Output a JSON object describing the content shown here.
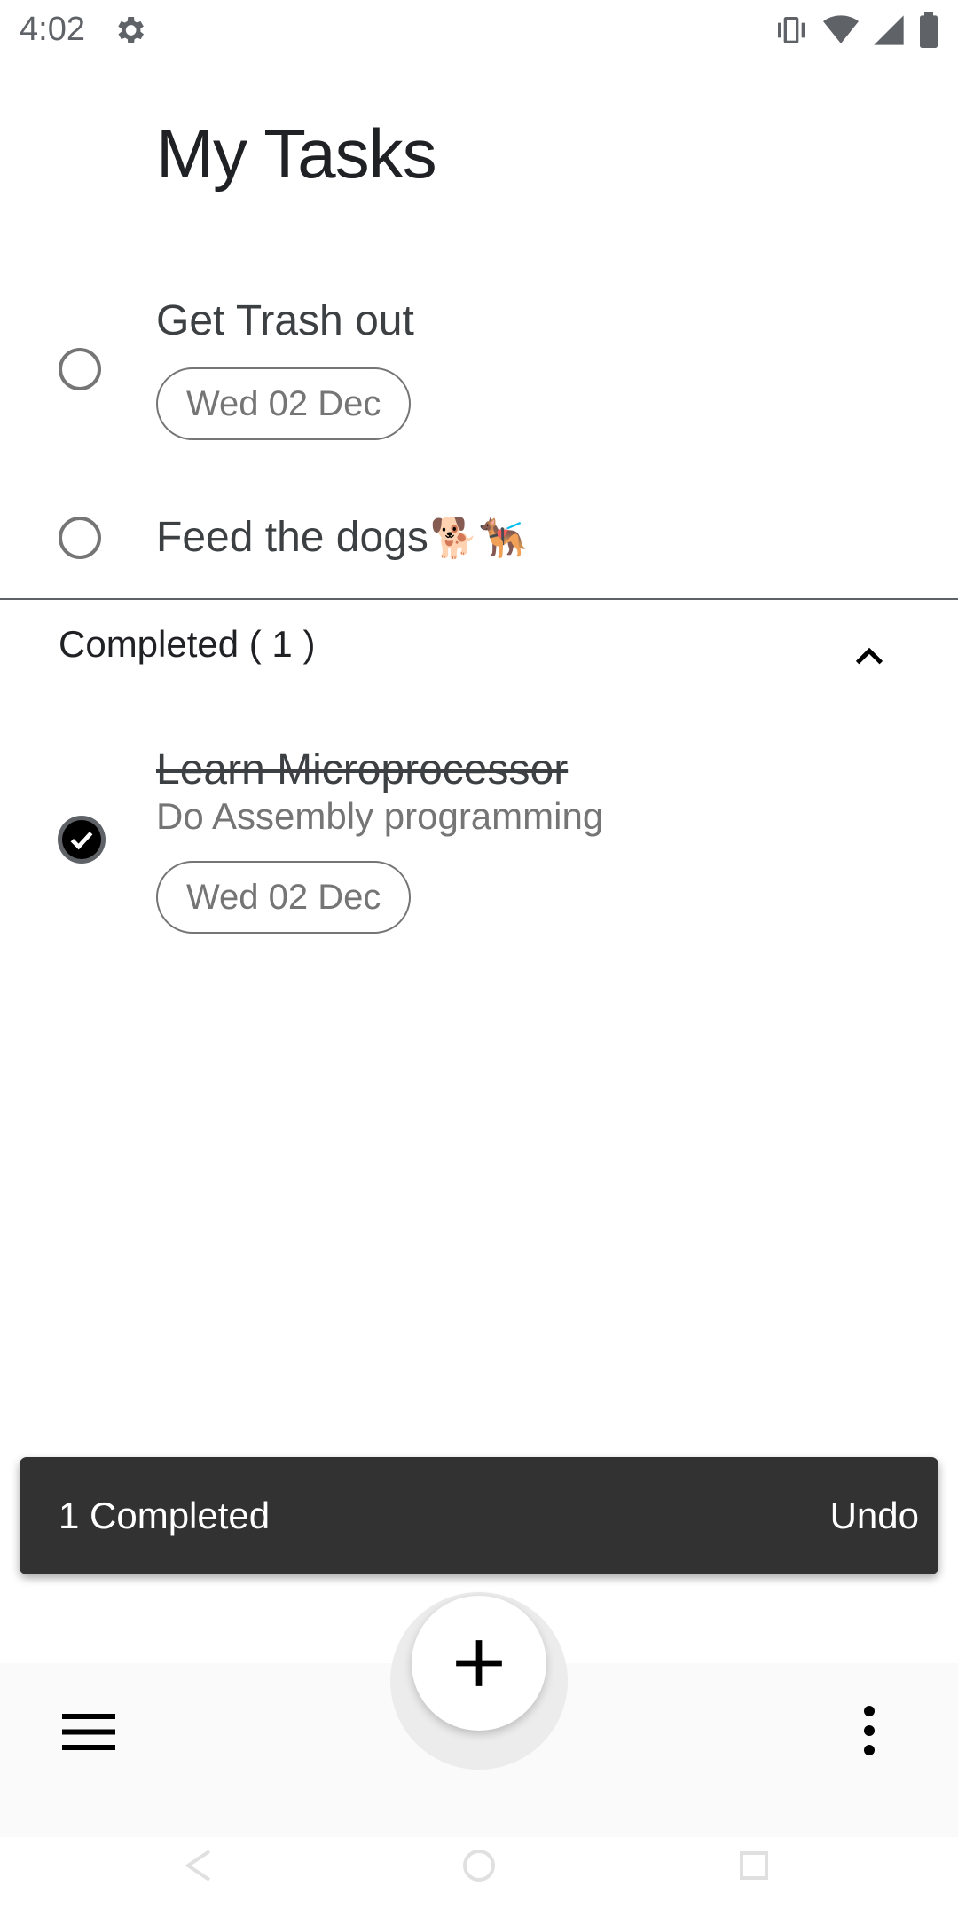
{
  "status_bar": {
    "time": "4:02",
    "icons": [
      "gear-icon",
      "vibrate-icon",
      "wifi-icon",
      "signal-icon",
      "battery-icon"
    ]
  },
  "page_title": "My Tasks",
  "tasks": [
    {
      "title": "Get Trash out",
      "due": "Wed 02 Dec",
      "completed": false
    },
    {
      "title": "Feed the dogs",
      "emoji": "🐕🐕‍🦺",
      "completed": false
    }
  ],
  "completed_section": {
    "header": "Completed ( 1 )",
    "expanded": true,
    "tasks": [
      {
        "title": "Learn Microprocessor",
        "notes": "Do Assembly programming",
        "due": "Wed 02 Dec",
        "completed": true
      }
    ]
  },
  "snackbar": {
    "message": "1 Completed",
    "action": "Undo"
  },
  "bottom_bar": {
    "menu_icon": "hamburger-menu-icon",
    "fab_icon": "plus-icon",
    "more_icon": "more-vert-icon"
  },
  "navigation_bar": {
    "icons": [
      "back-icon",
      "home-icon",
      "recents-icon"
    ]
  },
  "colors": {
    "snackbar_bg": "#323232",
    "chip_border": "#757575",
    "text_primary": "#202124",
    "text_secondary": "#757575"
  }
}
